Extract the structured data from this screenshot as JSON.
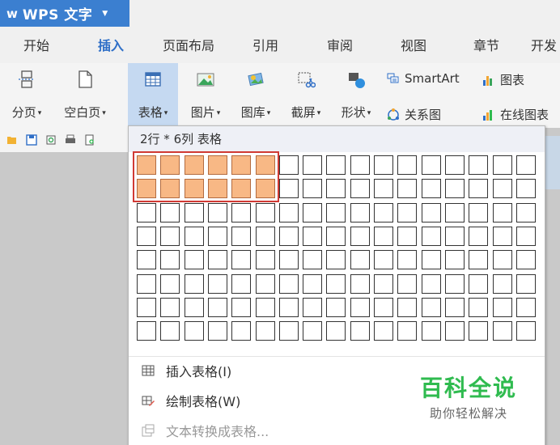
{
  "app": {
    "logo_glyph": "ᴡ",
    "title": "WPS 文字",
    "menu_arrow": "▼"
  },
  "tabs": [
    {
      "label": "开始"
    },
    {
      "label": "插入"
    },
    {
      "label": "页面布局"
    },
    {
      "label": "引用"
    },
    {
      "label": "审阅"
    },
    {
      "label": "视图"
    },
    {
      "label": "章节"
    },
    {
      "label": "开发"
    }
  ],
  "ribbon": {
    "page_break": "分页",
    "blank_page": "空白页",
    "table": "表格",
    "picture": "图片",
    "gallery": "图库",
    "screenshot": "截屏",
    "shapes": "形状",
    "smartart": "SmartArt",
    "relation_chart": "关系图",
    "chart": "图表",
    "online_chart": "在线图表",
    "dropdown_glyph": "▾"
  },
  "table_dropdown": {
    "header": "2行 * 6列 表格",
    "rows": 8,
    "cols": 17,
    "selected_rows": 2,
    "selected_cols": 6,
    "commands": [
      {
        "label": "插入表格(I)",
        "disabled": false
      },
      {
        "label": "绘制表格(W)",
        "disabled": false
      },
      {
        "label": "文本转换成表格...",
        "disabled": true
      }
    ]
  },
  "watermark": {
    "title": "百科全说",
    "subtitle": "助你轻松解决"
  },
  "colors": {
    "accent_blue": "#3b7fd0",
    "active_tab": "#2f6fc7",
    "cell_selected": "#f8b885",
    "selection_outline": "#d03a34",
    "watermark_green": "#2fbb4f"
  }
}
